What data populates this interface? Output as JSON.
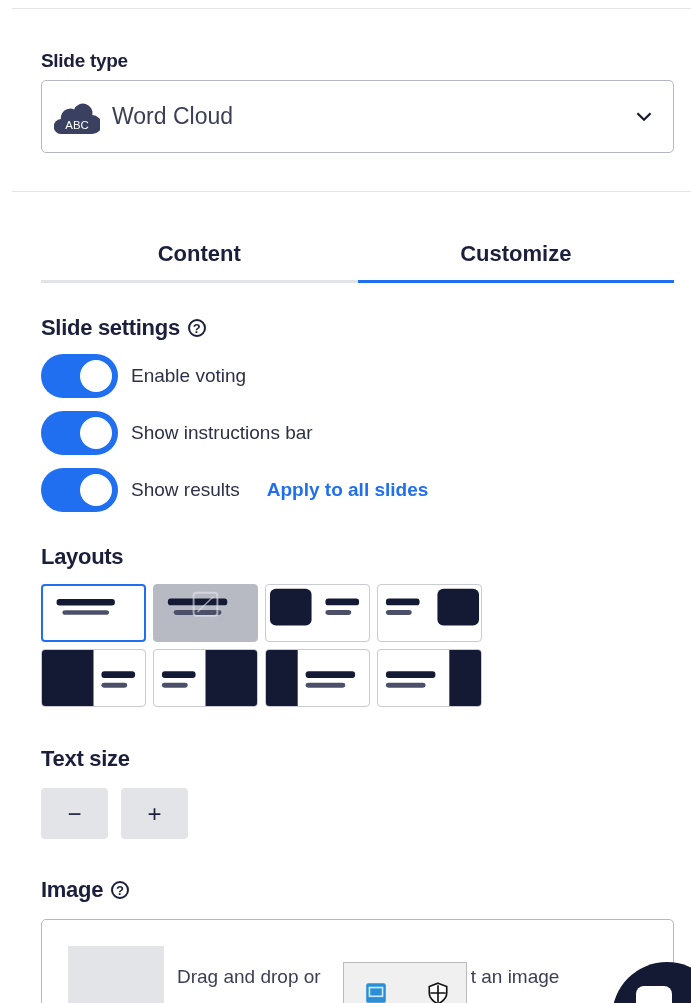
{
  "slide_type": {
    "label": "Slide type",
    "value": "Word Cloud",
    "icon_text": "ABC"
  },
  "tabs": [
    {
      "label": "Content",
      "selected": false
    },
    {
      "label": "Customize",
      "selected": true
    }
  ],
  "slide_settings": {
    "title": "Slide settings",
    "help": "?",
    "toggles": [
      {
        "label": "Enable voting",
        "on": true
      },
      {
        "label": "Show instructions bar",
        "on": true
      },
      {
        "label": "Show results",
        "on": true,
        "link": "Apply to all slides"
      }
    ]
  },
  "layouts": {
    "title": "Layouts",
    "options": [
      {
        "kind": "text-center",
        "selected": true,
        "highlighted": false
      },
      {
        "kind": "image-behind",
        "selected": false,
        "highlighted": true
      },
      {
        "kind": "image-left",
        "selected": false,
        "highlighted": false
      },
      {
        "kind": "image-right",
        "selected": false,
        "highlighted": false
      },
      {
        "kind": "panel-left",
        "selected": false,
        "highlighted": false
      },
      {
        "kind": "panel-right",
        "selected": false,
        "highlighted": false
      },
      {
        "kind": "strip-left",
        "selected": false,
        "highlighted": false
      },
      {
        "kind": "strip-right",
        "selected": false,
        "highlighted": false
      }
    ]
  },
  "text_size": {
    "title": "Text size",
    "buttons": [
      "−",
      "+"
    ]
  },
  "image": {
    "title": "Image",
    "help": "?",
    "hint_start": "Drag and drop or",
    "hint_end": "t an image"
  }
}
